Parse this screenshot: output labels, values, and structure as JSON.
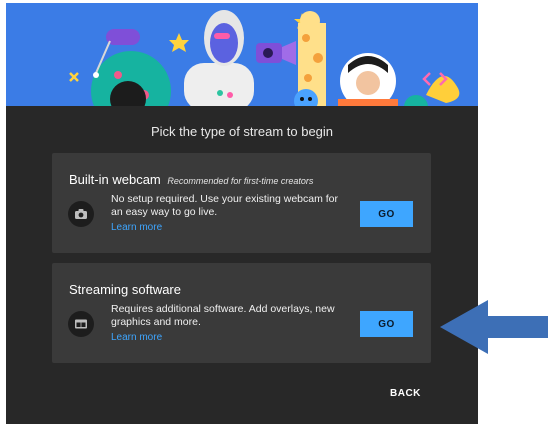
{
  "dialog": {
    "title": "Pick the type of stream to begin",
    "back_label": "BACK"
  },
  "cards": [
    {
      "title": "Built-in webcam",
      "subtitle": "Recommended for first-time creators",
      "description": "No setup required. Use your existing webcam for an easy way to go live.",
      "link": "Learn more",
      "button": "GO",
      "icon": "camera-icon"
    },
    {
      "title": "Streaming software",
      "subtitle": "",
      "description": "Requires additional software. Add overlays, new graphics and more.",
      "link": "Learn more",
      "button": "GO",
      "icon": "window-icon"
    }
  ],
  "colors": {
    "banner": "#3b7ce6",
    "dialog_bg": "#282828",
    "card_bg": "#3a3a3a",
    "accent": "#3ea6ff",
    "annotation_arrow": "#3d6fb6"
  }
}
